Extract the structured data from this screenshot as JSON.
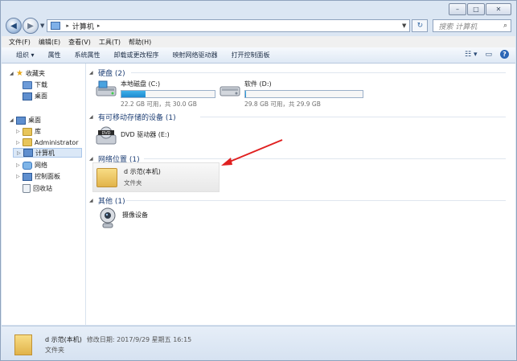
{
  "window": {
    "title": "计算机"
  },
  "caption": {
    "minimize": "–",
    "maximize": "□",
    "close": "✕"
  },
  "address": {
    "path": "计算机",
    "search_placeholder": "搜索 计算机"
  },
  "menu": [
    "文件(F)",
    "编辑(E)",
    "查看(V)",
    "工具(T)",
    "帮助(H)"
  ],
  "toolbar": {
    "items": [
      "组织 ▾",
      "属性",
      "系统属性",
      "卸载或更改程序",
      "映射网络驱动器",
      "打开控制面板"
    ]
  },
  "nav": {
    "favorites": "收藏夹",
    "downloads": "下载",
    "desktop_fav": "桌面",
    "desktop": "桌面",
    "library": "库",
    "user": "Administrator",
    "computer": "计算机",
    "network": "网络",
    "control_panel": "控制面板",
    "recycle": "回收站"
  },
  "groups": {
    "hdd": "硬盘 (2)",
    "removable": "有可移动存储的设备 (1)",
    "netloc": "网络位置 (1)",
    "other": "其他 (1)"
  },
  "drives": [
    {
      "name": "本地磁盘 (C:)",
      "size_text": "22.2 GB 可用，共 30.0 GB",
      "used_fraction": 0.26
    },
    {
      "name": "软件 (D:)",
      "size_text": "29.8 GB 可用，共 29.9 GB",
      "used_fraction": 0.01
    }
  ],
  "dvd": {
    "name": "DVD 驱动器 (E:)",
    "badge": "DVD"
  },
  "network_location": {
    "name": "d 示范(本机)",
    "type": "文件夹"
  },
  "other_device": {
    "name": "摄像设备"
  },
  "status": {
    "name": "d 示范(本机)",
    "modified": "修改日期: 2017/9/29 星期五 16:15",
    "type": "文件夹"
  },
  "colors": {
    "accent": "#1e8ad0",
    "annotation_arrow": "#e02020",
    "group_header": "#1e3f75"
  }
}
